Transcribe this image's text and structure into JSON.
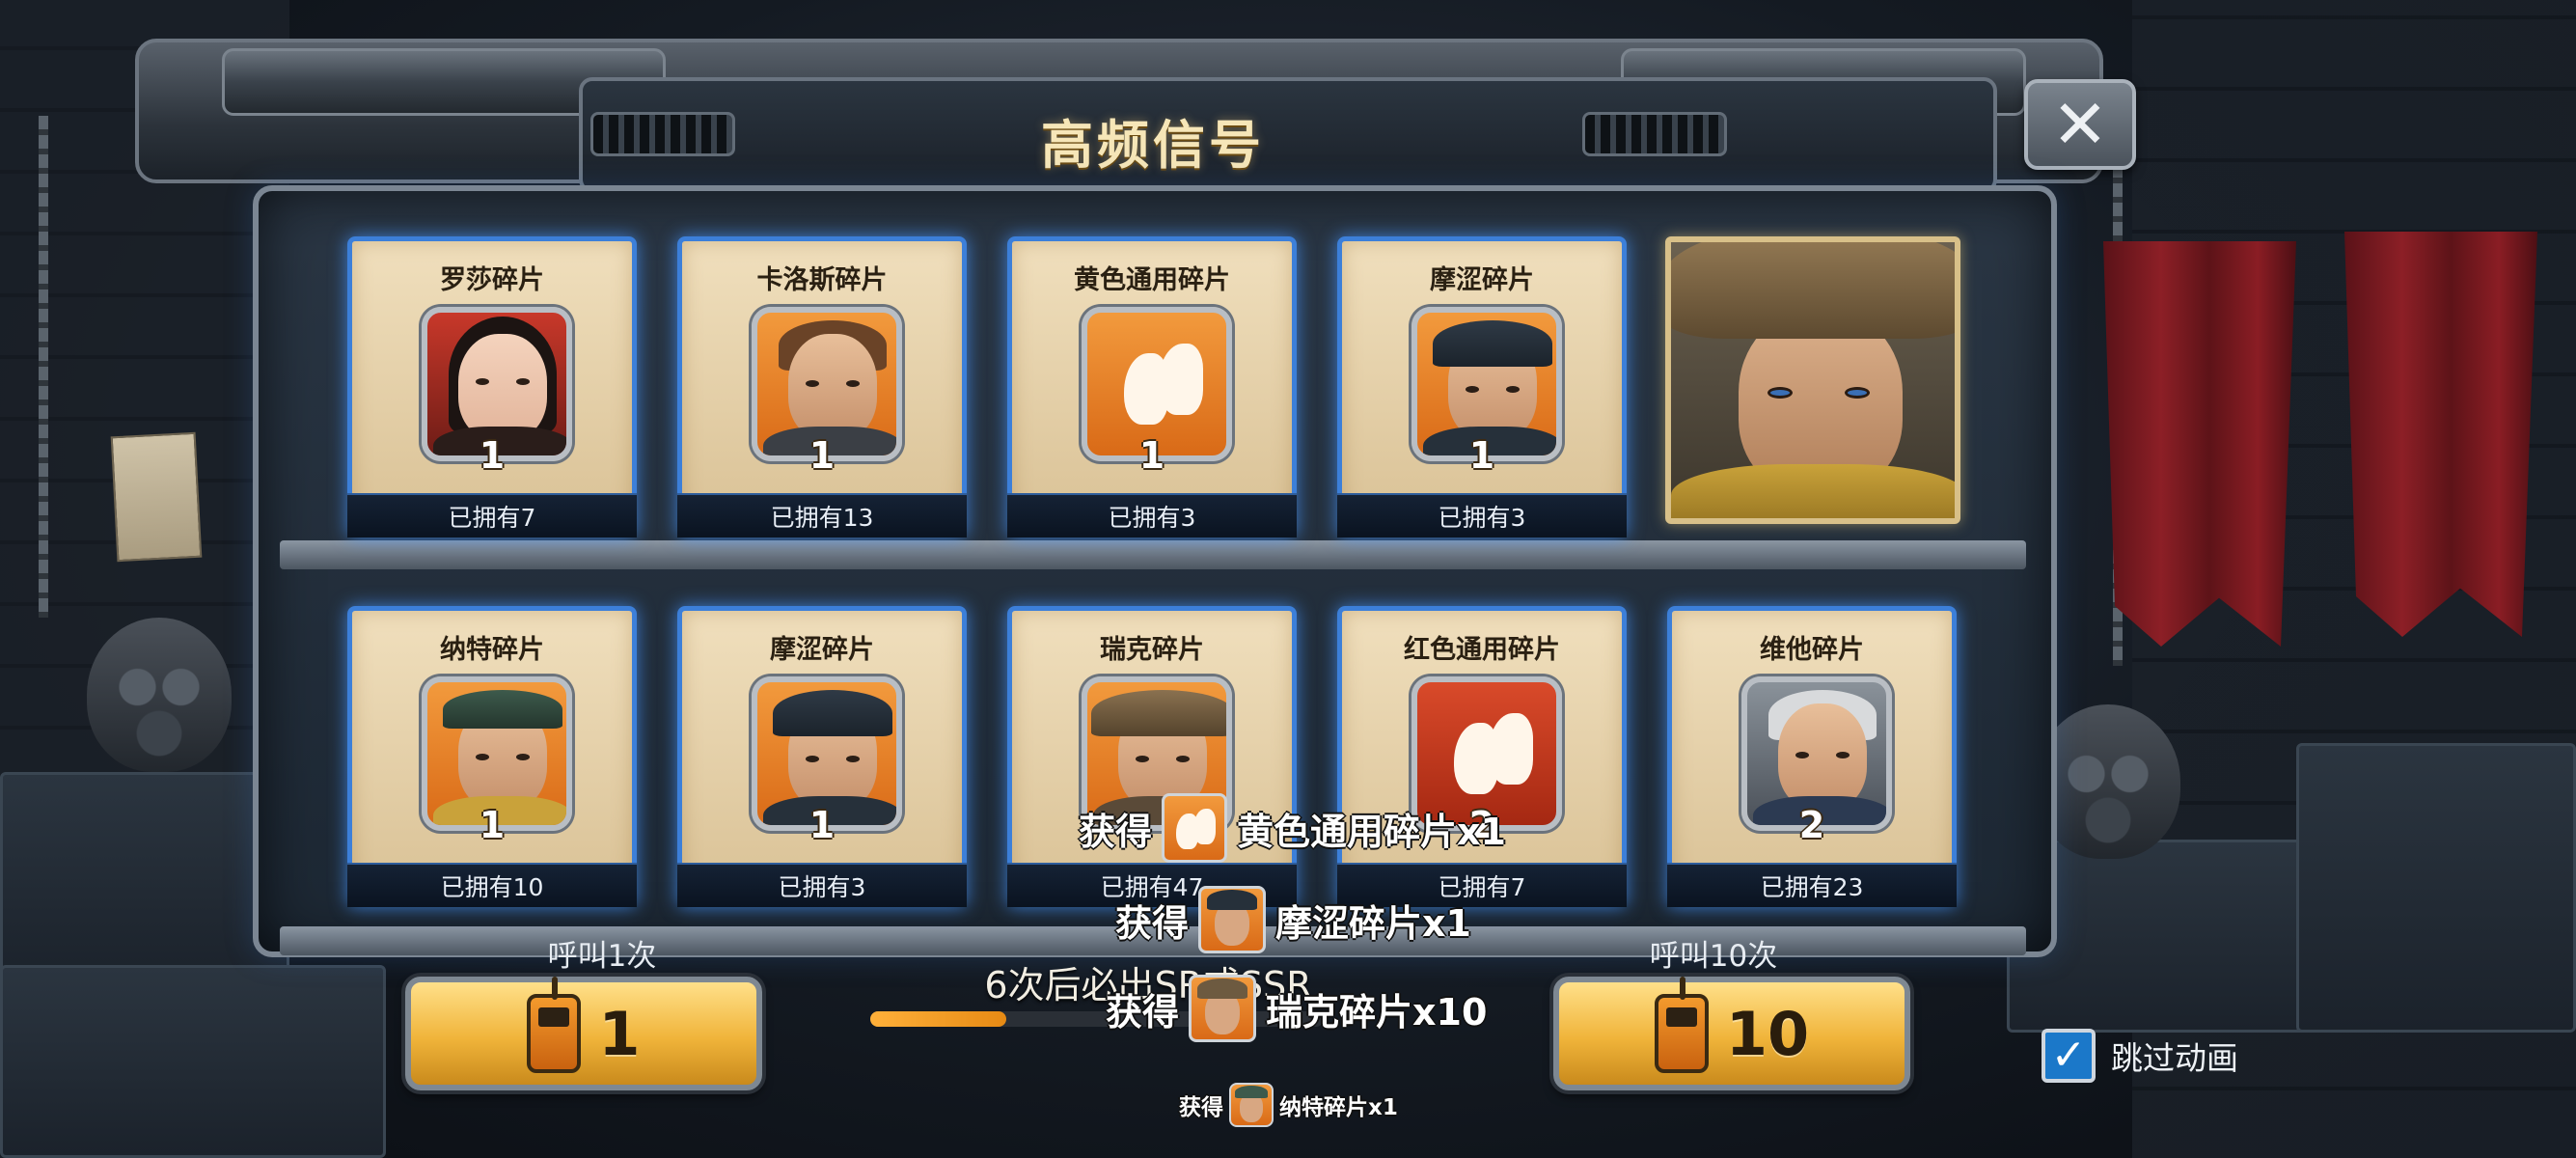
{
  "title": "高频信号",
  "cards_row1": [
    {
      "name": "罗莎碎片",
      "count": "1",
      "owned": "已拥有7",
      "type": "hero",
      "skin": "female"
    },
    {
      "name": "卡洛斯碎片",
      "count": "1",
      "owned": "已拥有13",
      "type": "hero",
      "skin": "male-brown"
    },
    {
      "name": "黄色通用碎片",
      "count": "1",
      "owned": "已拥有3",
      "type": "generic-yellow"
    },
    {
      "name": "摩涩碎片",
      "count": "1",
      "owned": "已拥有3",
      "type": "hero",
      "skin": "male-cap"
    }
  ],
  "cards_row2": [
    {
      "name": "纳特碎片",
      "count": "1",
      "owned": "已拥有10",
      "type": "hero",
      "skin": "male-beret"
    },
    {
      "name": "摩涩碎片",
      "count": "1",
      "owned": "已拥有3",
      "type": "hero",
      "skin": "male-cap"
    },
    {
      "name": "瑞克碎片",
      "count": "",
      "owned": "已拥有47",
      "type": "hero",
      "skin": "male-hat"
    },
    {
      "name": "红色通用碎片",
      "count": "2",
      "owned": "已拥有7",
      "type": "generic-red"
    },
    {
      "name": "维他碎片",
      "count": "2",
      "owned": "已拥有23",
      "type": "hero",
      "skin": "male-old"
    }
  ],
  "call_once": {
    "label": "呼叫1次",
    "value": "1"
  },
  "call_ten": {
    "label": "呼叫10次",
    "value": "10"
  },
  "guarantee_text": "6次后必出SR或SSR",
  "guarantee_progress": 0.3,
  "rewards": [
    {
      "prefix": "获得",
      "text": "黄色通用碎片x1"
    },
    {
      "prefix": "获得",
      "text": "摩涩碎片x1"
    },
    {
      "prefix": "获得",
      "text": "瑞克碎片x10"
    },
    {
      "prefix": "获得",
      "text": "纳特碎片x1"
    }
  ],
  "skip_animation": {
    "label": "跳过动画",
    "checked": true
  },
  "colors": {
    "card_border": "#3c7fd9",
    "button_gold": "#f0b43a",
    "title": "#f6e6b8",
    "checkbox": "#1b78c9"
  },
  "icons": {
    "close": "close-icon",
    "radio": "walkie-talkie-icon",
    "check": "checkmark-icon"
  }
}
